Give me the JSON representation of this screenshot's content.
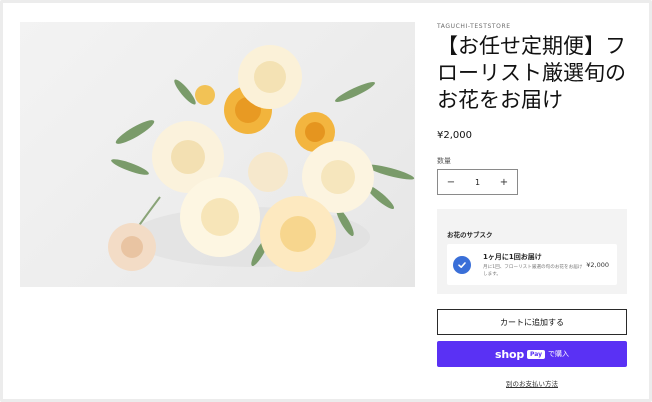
{
  "product": {
    "vendor": "TAGUCHI-TESTSTORE",
    "title": "【お任せ定期便】フローリスト厳選旬のお花をお届け",
    "price": "¥2,000",
    "image_icon": "flower-bouquet-image"
  },
  "quantity": {
    "label": "数量",
    "value": "1",
    "decrease": "−",
    "increase": "+"
  },
  "subscription": {
    "title": "お花のサブスク",
    "option": {
      "name": "1ヶ月に1回お届け",
      "description": "月に1回、フローリスト厳選の旬のお花をお届けします。",
      "price": "¥2,000",
      "selected": true
    }
  },
  "actions": {
    "add_to_cart": "カートに追加する",
    "shop_pay_brand": "shop",
    "shop_pay_chip": "Pay",
    "shop_pay_label": "で購入",
    "more_payment": "別のお支払い方法"
  },
  "colors": {
    "accent_shop_pay": "#5a31f4",
    "check_blue": "#3a6fd8",
    "text": "#121212"
  }
}
